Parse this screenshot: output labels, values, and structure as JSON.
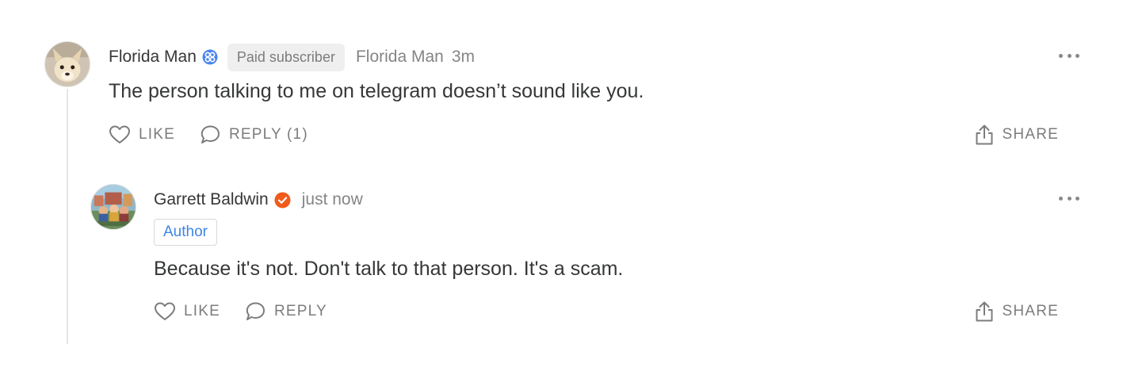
{
  "comments": [
    {
      "author": "Florida Man",
      "badge_icon": "subscriber-badge-icon",
      "badge_color": "#4a86f0",
      "subscriber_label": "Paid subscriber",
      "handle": "Florida Man",
      "time": "3m",
      "body": "The person talking to me on telegram doesn’t sound like you.",
      "actions": {
        "like": "LIKE",
        "reply": "REPLY (1)",
        "share": "SHARE"
      }
    },
    {
      "author": "Garrett Baldwin",
      "badge_icon": "verified-check-icon",
      "badge_color": "#f05a1a",
      "time": "just now",
      "tag": "Author",
      "tag_color": "#3f84e5",
      "body": "Because it's not. Don't talk to that person. It's a scam.",
      "actions": {
        "like": "LIKE",
        "reply": "REPLY",
        "share": "SHARE"
      }
    }
  ],
  "icons": {
    "like": "heart-icon",
    "reply": "speech-bubble-icon",
    "share": "share-upload-icon",
    "more": "more-dots-icon"
  }
}
